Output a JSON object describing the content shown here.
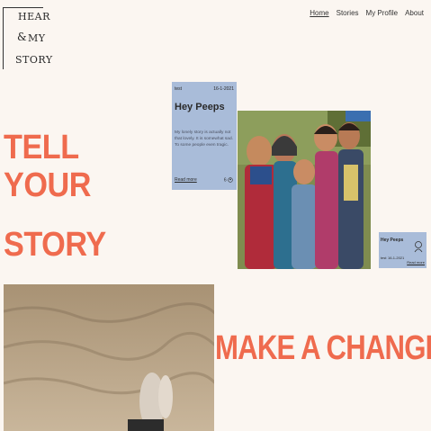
{
  "logo": {
    "line1": "HEAR",
    "line2": "MY",
    "line3": "STORY",
    "mark": "&"
  },
  "nav": {
    "items": [
      "Home",
      "Stories",
      "My Profile",
      "About"
    ]
  },
  "hero": {
    "line1": "TELL YOUR",
    "line2": "STORY"
  },
  "card": {
    "tag": "test",
    "date": "16-1-2021",
    "title": "Hey Peeps",
    "body": "My lonely story is actually not that lovely. It is somewhat sad. To some people even tragic.",
    "read_more": "Read more",
    "likes": "6"
  },
  "mini_card": {
    "title": "Hey Peeps",
    "tag": "test",
    "date": "16-1-2021",
    "read_more": "Read more"
  },
  "change": {
    "title": "MAKE A CHANGE"
  },
  "colors": {
    "accent": "#ef6b4e",
    "card": "#a9bcd9",
    "background": "#fbf6f1"
  }
}
